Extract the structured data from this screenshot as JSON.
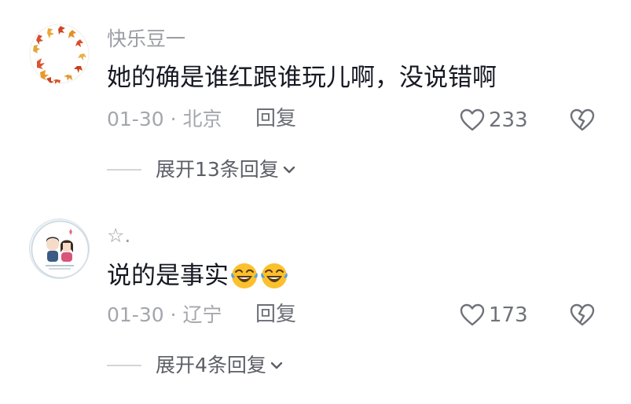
{
  "comments": [
    {
      "username": "快乐豆一",
      "content": "她的确是谁红跟谁玩儿啊，没说错啊",
      "date": "01-30",
      "separator": "·",
      "location": "北京",
      "reply_label": "回复",
      "likes": "233",
      "expand_label": "展开13条回复",
      "avatar": "autumn-leaves-avatar"
    },
    {
      "username": "☆.",
      "content": "说的是事实",
      "emojis": [
        "laughing-crying-emoji",
        "laughing-crying-emoji"
      ],
      "date": "01-30",
      "separator": "·",
      "location": "辽宁",
      "reply_label": "回复",
      "likes": "173",
      "expand_label": "展开4条回复",
      "avatar": "couple-cartoon-avatar"
    }
  ],
  "colors": {
    "text_primary": "#161823",
    "text_secondary": "#9a9ca3",
    "icon_gray": "#70727a"
  }
}
